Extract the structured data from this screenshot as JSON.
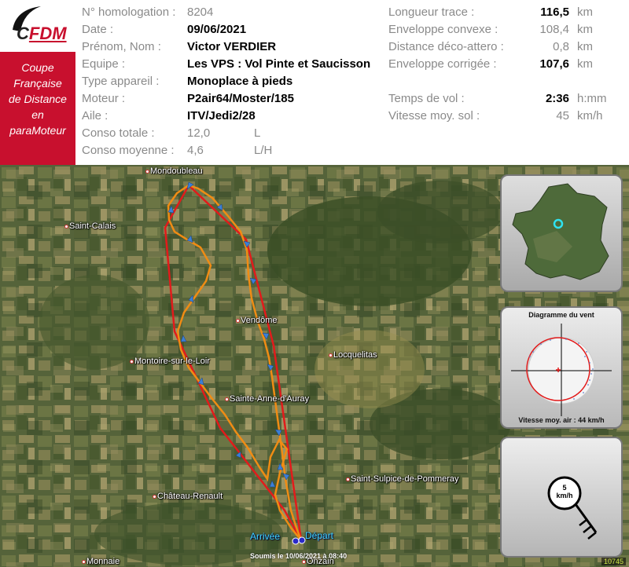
{
  "logo": {
    "text_c": "C",
    "text_fdm": "FDM"
  },
  "badge": [
    "Coupe",
    "Française",
    "de Distance",
    "en",
    "paraMoteur"
  ],
  "pilot": {
    "homologation_label": "N° homologation :",
    "homologation": "8204",
    "date_label": "Date :",
    "date": "09/06/2021",
    "name_label": "Prénom, Nom :",
    "name": "Victor VERDIER",
    "team_label": "Equipe :",
    "team": "Les VPS : Vol Pinte et Saucisson",
    "type_label": "Type appareil :",
    "type": "Monoplace à pieds",
    "engine_label": "Moteur :",
    "engine": "P2air64/Moster/185",
    "wing_label": "Aile :",
    "wing": "ITV/Jedi2/28",
    "total_label": "Conso totale :",
    "total": "12,0",
    "total_unit": "L",
    "avg_label": "Conso moyenne :",
    "avg": "4,6",
    "avg_unit": "L/H"
  },
  "stats": {
    "track_label": "Longueur trace :",
    "track": "116,5",
    "track_unit": "km",
    "convex_label": "Enveloppe convexe :",
    "convex": "108,4",
    "convex_unit": "km",
    "deco_label": "Distance déco-attero :",
    "deco": "0,8",
    "deco_unit": "km",
    "corrected_label": "Enveloppe corrigée :",
    "corrected": "107,6",
    "corrected_unit": "km",
    "time_label": "Temps de vol :",
    "time": "2:36",
    "time_unit": "h:mm",
    "speed_label": "Vitesse moy. sol :",
    "speed": "45",
    "speed_unit": "km/h"
  },
  "map": {
    "towns": [
      {
        "name": "Mondoubleau"
      },
      {
        "name": "Saint-Calais"
      },
      {
        "name": "Vendôme"
      },
      {
        "name": "Locquelitas"
      },
      {
        "name": "Montoire-sur-le-Loir"
      },
      {
        "name": "Sainte-Anne-d'Auray"
      },
      {
        "name": "Saint-Sulpice-de-Pommeray"
      },
      {
        "name": "Château-Renault"
      },
      {
        "name": "Monnaie"
      },
      {
        "name": "Onzain"
      }
    ],
    "arrival_label": "Arrivée",
    "departure_label": "Départ",
    "submitted": "Soumis le 10/06/2021 à 08:40",
    "flight_id": "10745",
    "colors": {
      "convex": "#e21b1b",
      "track": "#f08c14",
      "arrow": "#3b7fd6"
    }
  },
  "wind": {
    "title": "Diagramme du vent",
    "airspeed": "Vitesse moy. air : 44 km/h",
    "direction_speed_value": "5",
    "direction_speed_unit": "km/h"
  }
}
